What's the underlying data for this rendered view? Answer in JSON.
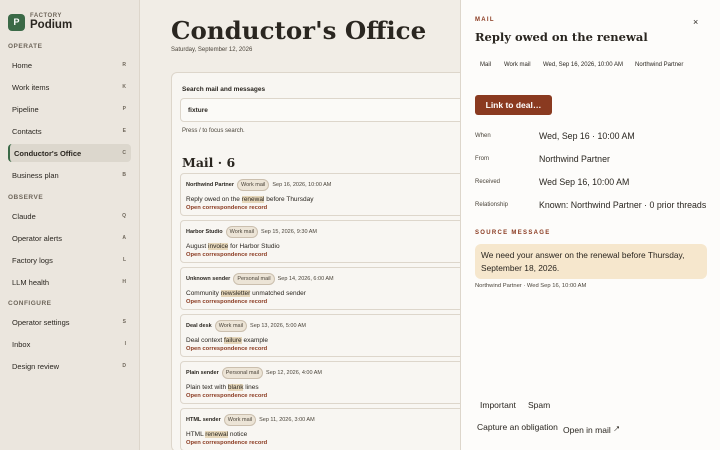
{
  "brand": {
    "kicker": "FACTORY",
    "name": "Podium",
    "logo_letter": "P"
  },
  "sidebar": {
    "sections": [
      {
        "label": "OPERATE",
        "items": [
          {
            "label": "Home",
            "key": "R"
          },
          {
            "label": "Work items",
            "key": "K"
          },
          {
            "label": "Pipeline",
            "key": "P"
          },
          {
            "label": "Contacts",
            "key": "E"
          },
          {
            "label": "Conductor's Office",
            "key": "C",
            "active": true
          },
          {
            "label": "Business plan",
            "key": "B"
          }
        ]
      },
      {
        "label": "OBSERVE",
        "items": [
          {
            "label": "Claude",
            "key": "Q"
          },
          {
            "label": "Operator alerts",
            "key": "A"
          },
          {
            "label": "Factory logs",
            "key": "L"
          },
          {
            "label": "LLM health",
            "key": "H"
          }
        ]
      },
      {
        "label": "CONFIGURE",
        "items": [
          {
            "label": "Operator settings",
            "key": "S"
          },
          {
            "label": "Inbox",
            "key": "I"
          },
          {
            "label": "Design review",
            "key": "D"
          }
        ]
      }
    ]
  },
  "main": {
    "title": "Conductor's Office",
    "date": "Saturday, September 12, 2026",
    "search": {
      "label": "Search mail and messages",
      "value": "fixture",
      "hint": "Press / to focus search."
    },
    "mail_heading": "Mail · 6",
    "open_link": "Open correspondence record",
    "mails": [
      {
        "sender": "Northwind Partner",
        "tag": "Work mail",
        "date": "Sep 16, 2026, 10:00 AM",
        "pre": "Reply owed on the ",
        "hl": "renewal",
        "post": " before Thursday"
      },
      {
        "sender": "Harbor Studio",
        "tag": "Work mail",
        "date": "Sep 15, 2026, 9:30 AM",
        "pre": "August ",
        "hl": "invoice",
        "post": " for Harbor Studio"
      },
      {
        "sender": "Unknown sender",
        "tag": "Personal mail",
        "date": "Sep 14, 2026, 6:00 AM",
        "pre": "Community ",
        "hl": "newsletter",
        "post": " unmatched sender"
      },
      {
        "sender": "Deal desk",
        "tag": "Work mail",
        "date": "Sep 13, 2026, 5:00 AM",
        "pre": "Deal context ",
        "hl": "failure",
        "post": " example"
      },
      {
        "sender": "Plain sender",
        "tag": "Personal mail",
        "date": "Sep 12, 2026, 4:00 AM",
        "pre": "Plain text with ",
        "hl": "blank",
        "post": " lines"
      },
      {
        "sender": "HTML sender",
        "tag": "Work mail",
        "date": "Sep 11, 2026, 3:00 AM",
        "pre": "HTML ",
        "hl": "renewal",
        "post": " notice"
      }
    ]
  },
  "drawer": {
    "kicker": "MAIL",
    "close": "×",
    "title": "Reply owed on the renewal",
    "meta": {
      "kind": "Mail",
      "tag": "Work mail",
      "date": "Wed, Sep 16, 2026, 10:00 AM",
      "sender": "Northwind Partner"
    },
    "link_button": "Link to deal…",
    "fields": {
      "when": {
        "label": "When",
        "value": "Wed, Sep 16 · 10:00 AM"
      },
      "from": {
        "label": "From",
        "value": "Northwind Partner"
      },
      "received": {
        "label": "Received",
        "value": "Wed Sep 16, 10:00 AM"
      },
      "relationship": {
        "label": "Relationship",
        "value": "Known: Northwind Partner · 0 prior threads"
      }
    },
    "source": {
      "kicker": "SOURCE MESSAGE",
      "message": "We need your answer on the renewal before Thursday, September 18, 2026.",
      "footer": "Northwind Partner · Wed Sep 16, 10:00 AM"
    },
    "actions": {
      "important": "Important",
      "spam": "Spam",
      "capture": "Capture an obligation",
      "open_mail": "Open in mail",
      "open_icon": "external-link-icon"
    }
  },
  "colors": {
    "accent": "#8a3a20",
    "brand": "#3b6a47",
    "highlight": "#e6d7ba",
    "source_bg": "#f6e7cd"
  }
}
